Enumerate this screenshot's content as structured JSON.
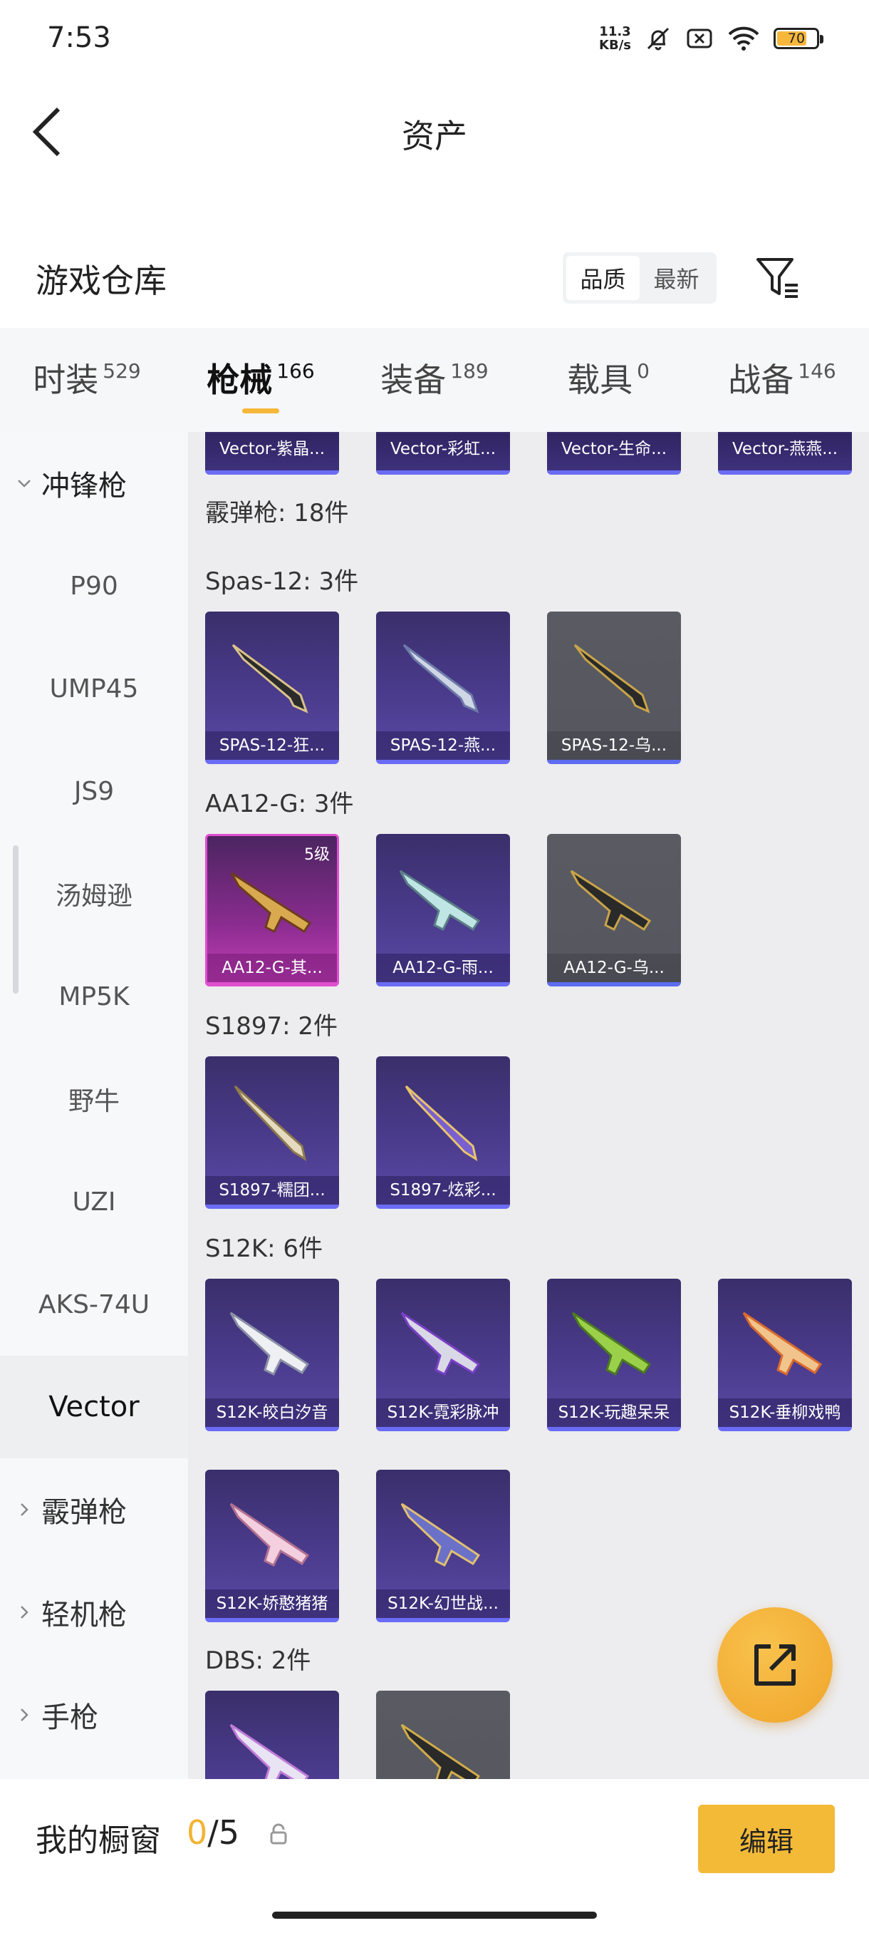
{
  "status_bar": {
    "time": "7:53",
    "net_speed_value": "11.3",
    "net_speed_unit": "KB/s",
    "battery": "70",
    "battery_level": 0.7
  },
  "header": {
    "title": "资产"
  },
  "section": {
    "title": "游戏仓库",
    "sort_quality": "品质",
    "sort_newest": "最新"
  },
  "tabs": [
    {
      "label": "时装",
      "count": "529"
    },
    {
      "label": "枪械",
      "count": "166"
    },
    {
      "label": "装备",
      "count": "189"
    },
    {
      "label": "载具",
      "count": "0"
    },
    {
      "label": "战备",
      "count": "146"
    }
  ],
  "sidebar": {
    "group_smg": "冲锋枪",
    "items": [
      "P90",
      "UMP45",
      "JS9",
      "汤姆逊",
      "MP5K",
      "野牛",
      "UZI",
      "AKS-74U",
      "Vector"
    ],
    "group_shotgun": "霰弹枪",
    "group_lmg": "轻机枪",
    "group_pistol": "手枪"
  },
  "content": {
    "vector_cards": [
      "Vector-紫晶...",
      "Vector-彩虹...",
      "Vector-生命...",
      "Vector-燕燕..."
    ],
    "shotgun_heading": "霰弹枪: 18件",
    "spas_heading": "Spas-12: 3件",
    "spas_cards": [
      "SPAS-12-狂...",
      "SPAS-12-燕...",
      "SPAS-12-乌..."
    ],
    "aa12_heading": "AA12-G: 3件",
    "aa12_cards": [
      "AA12-G-其...",
      "AA12-G-雨...",
      "AA12-G-乌..."
    ],
    "aa12_level": "5级",
    "s1897_heading": "S1897: 2件",
    "s1897_cards": [
      "S1897-糯团...",
      "S1897-炫彩..."
    ],
    "s12k_heading": "S12K: 6件",
    "s12k_cards": [
      "S12K-皎白汐音",
      "S12K-霓彩脉冲",
      "S12K-玩趣呆呆",
      "S12K-垂柳戏鸭",
      "S12K-娇憨猪猪",
      "S12K-幻世战..."
    ],
    "dbs_heading": "DBS: 2件"
  },
  "bottom": {
    "showcase_label": "我的橱窗",
    "showcase_used": "0",
    "showcase_total": "/5",
    "edit_label": "编辑"
  },
  "colors": {
    "accent": "#f3ba38",
    "card_purple": "#4a3b8c",
    "card_pink": "#c43fb8",
    "card_gray": "#55565e"
  }
}
